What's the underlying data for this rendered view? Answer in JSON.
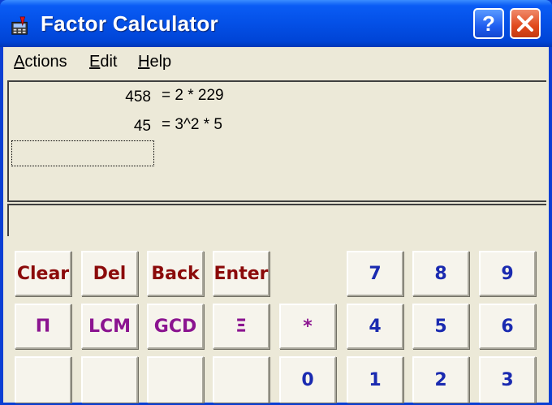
{
  "window": {
    "title": "Factor Calculator"
  },
  "menu": {
    "actions": {
      "accel": "A",
      "rest": "ctions"
    },
    "edit": {
      "accel": "E",
      "rest": "dit"
    },
    "help": {
      "accel": "H",
      "rest": "elp"
    }
  },
  "display": {
    "rows": [
      {
        "number": "458",
        "result": "= 2 * 229"
      },
      {
        "number": "45",
        "result": "= 3^2 * 5"
      }
    ]
  },
  "keys": {
    "clear": "Clear",
    "del": "Del",
    "back": "Back",
    "enter": "Enter",
    "pi": "Π",
    "lcm": "LCM",
    "gcd": "GCD",
    "sigma": "Ξ",
    "multiply": "*",
    "n7": "7",
    "n8": "8",
    "n9": "9",
    "n4": "4",
    "n5": "5",
    "n6": "6",
    "n0": "0",
    "n1": "1",
    "n2": "2",
    "n3": "3"
  },
  "colors": {
    "function_keys": "#8b0a0a",
    "math_keys": "#8b1490",
    "digit_keys": "#1a2ab0",
    "titlebar": "#0450e6"
  }
}
